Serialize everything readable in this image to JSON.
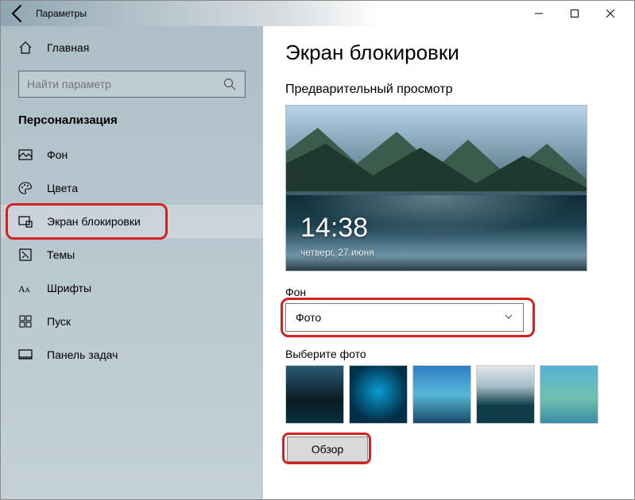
{
  "window": {
    "title": "Параметры"
  },
  "sidebar": {
    "home": "Главная",
    "search_placeholder": "Найти параметр",
    "section": "Персонализация",
    "items": [
      {
        "label": "Фон"
      },
      {
        "label": "Цвета"
      },
      {
        "label": "Экран блокировки"
      },
      {
        "label": "Темы"
      },
      {
        "label": "Шрифты"
      },
      {
        "label": "Пуск"
      },
      {
        "label": "Панель задач"
      }
    ]
  },
  "content": {
    "heading": "Экран блокировки",
    "preview_label": "Предварительный просмотр",
    "preview_time": "14:38",
    "preview_date": "четверг, 27 июня",
    "bg_label": "Фон",
    "bg_value": "Фото",
    "choose_label": "Выберите фото",
    "browse": "Обзор"
  }
}
